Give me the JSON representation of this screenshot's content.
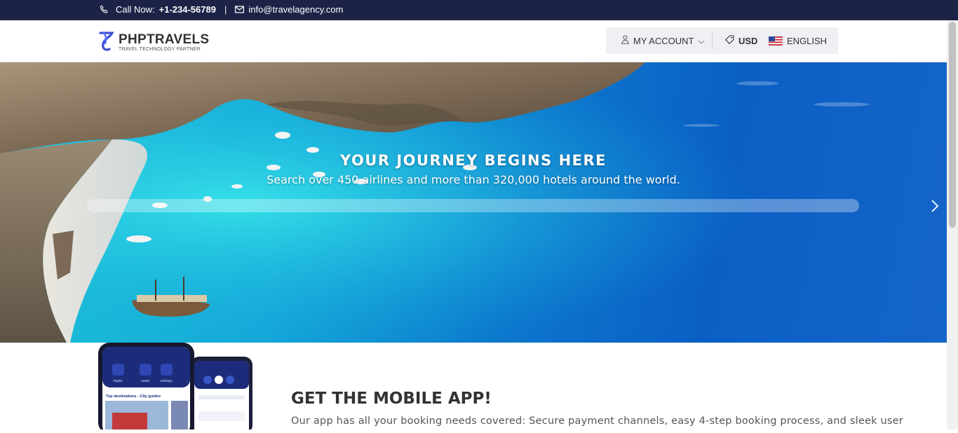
{
  "topbar": {
    "call_label": "Call Now:",
    "phone": "+1-234-56789",
    "separator": "|",
    "email": "info@travelagency.com",
    "icons": {
      "phone": "phone-icon",
      "email": "envelope-icon"
    }
  },
  "header": {
    "logo_name": "PHPTRAVELS",
    "logo_tagline": "TRAVEL TECHNOLOGY PARTNER",
    "account_label": "MY ACCOUNT",
    "currency": "USD",
    "language": "ENGLISH",
    "icons": {
      "account": "user-icon",
      "dropdown": "chevron-down-icon",
      "currency": "tag-icon",
      "language": "us-flag-icon"
    }
  },
  "hero": {
    "title": "YOUR JOURNEY BEGINS HERE",
    "subtitle": "Search over 450 airlines and more than 320,000 hotels around the world.",
    "next_icon": "chevron-right-icon"
  },
  "app_section": {
    "title": "GET THE MOBILE APP!",
    "description": "Our app has all your booking needs covered: Secure payment channels, easy 4-step booking process, and sleek user",
    "phone_screen": {
      "tabs": [
        "Flights",
        "Hotels",
        "Holidays"
      ],
      "section_title": "Top destinations - City guides"
    }
  },
  "colors": {
    "topbar_bg": "#1d2347",
    "header_panel_bg": "#eef0f3",
    "app_title": "#333333",
    "sea_primary": "#0c78cd"
  }
}
